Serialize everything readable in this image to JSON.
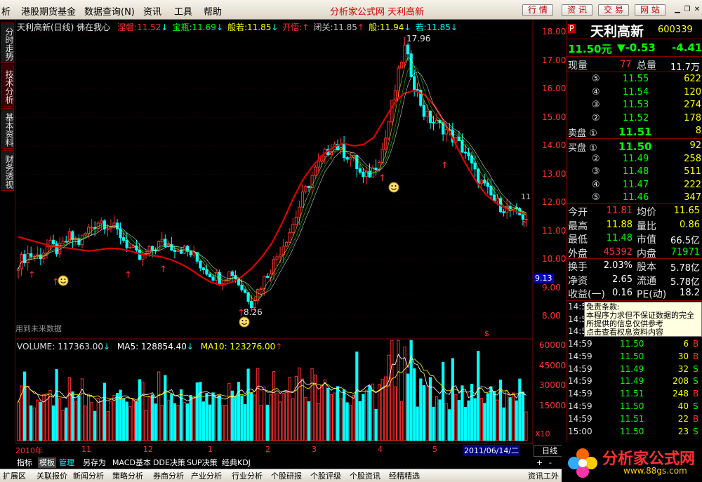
{
  "menubar": {
    "items": [
      "析",
      "港股期货基金",
      "数据查询(N)",
      "资讯",
      "工具",
      "帮助"
    ],
    "brand": "分析家公式网  天利高新",
    "buttons": [
      "行 情",
      "资 讯",
      "交 易",
      "网 站"
    ]
  },
  "left_tabs": [
    "分时走势",
    "技术分析",
    "基本资料",
    "财务透视"
  ],
  "chart_header": {
    "title": "天利高新(日线) 佛在我心",
    "items": [
      {
        "label": "涅磐:",
        "value": "11.52",
        "color": "#ff3030",
        "arrow": "↓"
      },
      {
        "label": "宝瓶:",
        "value": "11.69",
        "color": "#00ff00",
        "arrow": "↓"
      },
      {
        "label": "般若:",
        "value": "11.85",
        "color": "#ffff00",
        "arrow": "↓"
      },
      {
        "label": "开悟:",
        "value": "",
        "color": "#ff3030",
        "arrow": "↑"
      },
      {
        "label": "闭关:",
        "value": "11.85",
        "color": "#c0c0c0",
        "arrow": "↑"
      },
      {
        "label": "般:",
        "value": "11.94",
        "color": "#ffff00",
        "arrow": "↓"
      },
      {
        "label": "若:",
        "value": "11.85",
        "color": "#00ffff",
        "arrow": "↓"
      }
    ]
  },
  "annotations": {
    "high": "17.96",
    "low": "8.26",
    "future": "用到未来数据",
    "right_cut": "11",
    "s_mark": "$"
  },
  "volume_header": {
    "vol": "VOLUME: 117363.00",
    "vol_arrow": "↓",
    "ma5": "MA5: 128854.40",
    "ma5_arrow": "↓",
    "ma10": "MA10: 123276.00",
    "ma10_arrow": "↑"
  },
  "chart_data": {
    "type": "candlestick",
    "price_ticks": [
      "18.00",
      "17.00",
      "16.00",
      "15.00",
      "14.00",
      "13.00",
      "12.00",
      "11.00",
      "10.00",
      "9.00",
      "8.00"
    ],
    "price_values": [
      18,
      17,
      16,
      15,
      14,
      13,
      12,
      11,
      10,
      9,
      8
    ],
    "current_price_tag": "9.13",
    "volume_ticks": [
      "60000",
      "45000",
      "30000",
      "15000"
    ],
    "volume_values": [
      60000,
      45000,
      30000,
      15000
    ],
    "volume_multiplier": "X10",
    "x_labels": [
      "2010年",
      "11",
      "12",
      "1",
      "2",
      "3",
      "4",
      "5",
      "2011/06/14/二"
    ],
    "close_series": [
      9.9,
      10.2,
      10.1,
      10.5,
      10.3,
      10.8,
      10.6,
      11.1,
      11.4,
      11.2,
      10.9,
      10.4,
      10.0,
      10.3,
      10.6,
      10.5,
      10.4,
      10.2,
      9.8,
      9.5,
      9.3,
      9.6,
      9.0,
      8.5,
      9.2,
      9.8,
      10.5,
      11.2,
      12.2,
      13.0,
      13.6,
      14.1,
      13.8,
      13.5,
      12.8,
      13.2,
      14.0,
      15.8,
      17.5,
      16.2,
      15.1,
      14.8,
      14.6,
      14.2,
      13.8,
      13.0,
      12.5,
      12.0,
      11.8,
      11.6,
      11.5
    ],
    "ma_series": [
      10.8,
      10.7,
      10.6,
      10.5,
      10.45,
      10.4,
      10.35,
      10.3,
      10.35,
      10.4,
      10.38,
      10.3,
      10.2,
      10.15,
      10.1,
      10.0,
      9.85,
      9.65,
      9.4,
      9.2,
      9.1,
      9.2,
      9.4,
      9.7,
      10.1,
      10.6,
      11.3,
      12.1,
      12.8,
      13.3,
      13.7,
      13.95,
      14.1,
      14.0,
      14.05,
      14.3,
      14.9,
      15.5,
      15.85,
      15.95,
      15.8,
      15.4,
      14.8,
      14.1,
      13.4,
      12.8,
      12.3,
      12.0,
      11.8,
      11.7,
      11.6
    ]
  },
  "quote": {
    "name": "天利高新",
    "code": "600339",
    "price": "11.50元",
    "change": "▼-0.53",
    "pct": "-4.41",
    "xianliang_label": "现量",
    "xianliang": "77",
    "zongliang_label": "总量",
    "zongliang": "11.7万",
    "sell": [
      {
        "label": "⑤",
        "price": "11.55",
        "vol": "622"
      },
      {
        "label": "④",
        "price": "11.54",
        "vol": "120"
      },
      {
        "label": "③",
        "price": "11.53",
        "vol": "274"
      },
      {
        "label": "②",
        "price": "11.52",
        "vol": "178"
      },
      {
        "label": "卖盘 ①",
        "price": "11.51",
        "vol": "8"
      }
    ],
    "buy": [
      {
        "label": "买盘 ①",
        "price": "11.50",
        "vol": "92"
      },
      {
        "label": "②",
        "price": "11.49",
        "vol": "258"
      },
      {
        "label": "③",
        "price": "11.48",
        "vol": "511"
      },
      {
        "label": "④",
        "price": "11.47",
        "vol": "222"
      },
      {
        "label": "⑤",
        "price": "11.46",
        "vol": "347"
      }
    ],
    "stats": [
      {
        "l1": "今开",
        "v1": "11.81",
        "c1": "#ff3030",
        "l2": "均价",
        "v2": "11.65",
        "c2": "#ffff00"
      },
      {
        "l1": "最高",
        "v1": "11.88",
        "c1": "#ffff00",
        "l2": "量比",
        "v2": "0.86",
        "c2": "#ffff00"
      },
      {
        "l1": "最低",
        "v1": "11.48",
        "c1": "#00ff00",
        "l2": "市值",
        "v2": "66.5亿",
        "c2": "#ffffff"
      },
      {
        "l1": "外盘",
        "v1": "45392",
        "c1": "#ff3030",
        "l2": "内盘",
        "v2": "71971",
        "c2": "#00ff00"
      },
      {
        "l1": "换手",
        "v1": "2.03%",
        "c1": "#ffffff",
        "l2": "股本",
        "v2": "5.78亿",
        "c2": "#ffffff"
      },
      {
        "l1": "净资",
        "v1": "2.65",
        "c1": "#ffffff",
        "l2": "流通",
        "v2": "5.78亿",
        "c2": "#ffffff"
      },
      {
        "l1": "收益(一)",
        "v1": "0.16",
        "c1": "#ffffff",
        "l2": "PE(动)",
        "v2": "18.2",
        "c2": "#ffffff"
      }
    ],
    "ticks": [
      {
        "t": "14:59",
        "p": "11.50",
        "v": "6",
        "bs": "B"
      },
      {
        "t": "14:59",
        "p": "11.50",
        "v": "30",
        "bs": "B"
      },
      {
        "t": "14:59",
        "p": "11.49",
        "v": "32",
        "bs": "S"
      },
      {
        "t": "14:59",
        "p": "11.49",
        "v": "208",
        "bs": "S"
      },
      {
        "t": "14:59",
        "p": "11.51",
        "v": "248",
        "bs": "B"
      },
      {
        "t": "14:59",
        "p": "11.50",
        "v": "40",
        "bs": "S"
      },
      {
        "t": "14:59",
        "p": "11.51",
        "v": "22",
        "bs": "B"
      },
      {
        "t": "15:00",
        "p": "11.50",
        "v": "23",
        "bs": "S"
      }
    ],
    "tick_partial": [
      "14:5",
      "14:5",
      "14:5"
    ]
  },
  "tooltip": {
    "title": "免责条款:",
    "lines": [
      "本程序力求但不保证数据的完全",
      "所提供的信息仅供参考",
      "点击查看权息资料内容"
    ]
  },
  "bottom_tabs": [
    "指标",
    "模板",
    "管理",
    "另存为",
    "MACD基本",
    "DDE决策",
    "SUP决策",
    "经典KDJ"
  ],
  "period_label": "日线",
  "small_btns": [
    "+",
    "-"
  ],
  "status_bar": [
    "扩展区",
    "关联报价",
    "新闻分析",
    "策略分析",
    "券商分析",
    "产业分析",
    "行业分析",
    "个股研报",
    "个股评级",
    "个股资讯",
    "经精精选"
  ],
  "status_right": "资讯工外",
  "logo": {
    "text": "分析家公式网",
    "url": "www.88gs.com"
  },
  "colors": {
    "up": "#ff3030",
    "down": "#00ffff",
    "ma": "#e00000",
    "grid": "#800000"
  }
}
